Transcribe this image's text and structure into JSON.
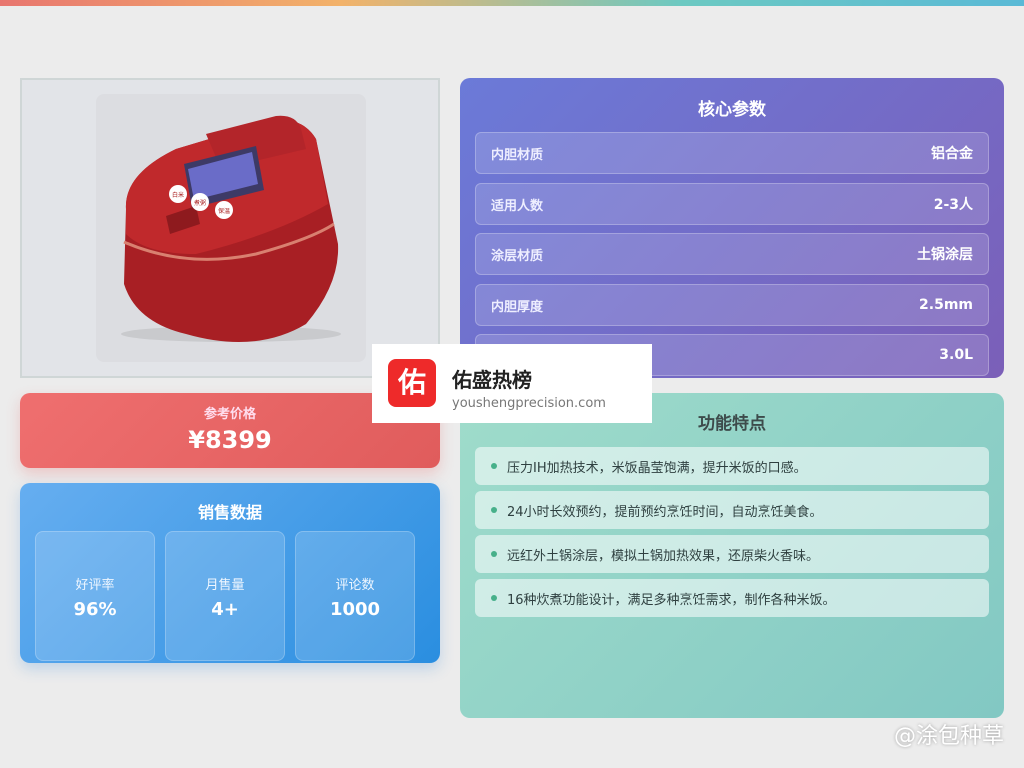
{
  "price": {
    "label": "参考价格",
    "value": "¥8399"
  },
  "sales": {
    "title": "销售数据",
    "stats": [
      {
        "label": "好评率",
        "value": "96%"
      },
      {
        "label": "月售量",
        "value": "4+"
      },
      {
        "label": "评论数",
        "value": "1000"
      }
    ]
  },
  "params": {
    "title": "核心参数",
    "rows": [
      {
        "name": "内胆材质",
        "value": "铝合金"
      },
      {
        "name": "适用人数",
        "value": "2-3人"
      },
      {
        "name": "涂层材质",
        "value": "土锅涂层"
      },
      {
        "name": "内胆厚度",
        "value": "2.5mm"
      },
      {
        "name": "",
        "value": "3.0L"
      }
    ]
  },
  "features": {
    "title": "功能特点",
    "items": [
      "压力IH加热技术，米饭晶莹饱满，提升米饭的口感。",
      "24小时长效预约，提前预约烹饪时间，自动烹饪美食。",
      "远红外土锅涂层，模拟土锅加热效果，还原柴火香味。",
      "16种炊煮功能设计，满足多种烹饪需求，制作各种米饭。"
    ]
  },
  "watermark": {
    "logo_char": "佑",
    "name": "佑盛热榜",
    "url": "youshengprecision.com",
    "corner": "@涂包种草"
  },
  "product": {
    "image_icon": "rice-cooker-icon",
    "button_labels": [
      "白米",
      "煮粥",
      "保温"
    ]
  },
  "colors": {
    "price": "#e8625f",
    "sales": "#3f9ae6",
    "params": "#7370cc",
    "features": "#8fd2c6"
  }
}
